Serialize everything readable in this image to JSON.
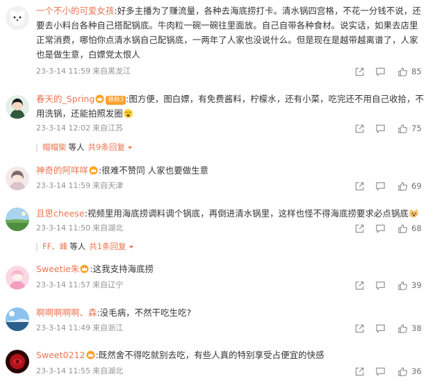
{
  "comments": [
    {
      "user": "一个不小的可爱女孩",
      "text": ":好多主播为了赚流量，各种去海底捞打卡。清水锅四宫格，不花一分钱不说，还要去小料台各种自己搭配锅底。牛肉粒一碗一碗往里面放。自己自带各种食材。说实话，如果去店里正常消费，哪怕你点清水锅自己配锅底，一两年了人家也没说什么。但是现在是越带越离谱了，人家也是做生意，白嫖党太恨人",
      "time": "23-3-14 11:59",
      "location": "来自黑龙江",
      "likes": "85"
    },
    {
      "user": "春天的_Spring",
      "fan_badge": "铁粉3",
      "text": ":图方便，图白嫖，有免费酱料，柠檬水，还有小菜，吃完还不用自己收拾，不用洗锅，还能拍照发圈",
      "time": "23-3-14 12:02",
      "location": "来自江苏",
      "likes": "75",
      "replies": {
        "name": "帽帽柴",
        "suffix": "等人",
        "more": "共9条回复"
      }
    },
    {
      "user": "神奇的阿咩咩",
      "text": ":很难不赞同 人家也要做生意",
      "time": "23-3-14 11:59",
      "location": "来自天津",
      "likes": "69"
    },
    {
      "user": "且思cheese",
      "text": ":视频里用海底捞调料调个锅底，再倒进清水锅里，这样也怪不得海底捞要求必点锅底",
      "time": "23-3-14 11:50",
      "location": "来自湖北",
      "likes": "68",
      "replies": {
        "name": "FF、峰",
        "suffix": "等人",
        "more": "共1条回复"
      }
    },
    {
      "user": "Sweetie朱",
      "text": ":这我支持海底捞",
      "time": "23-3-14 11:57",
      "location": "来自辽宁",
      "likes": "39"
    },
    {
      "user": "啊啊啊啊啊、森",
      "text": ":没毛病，不然干吃生吃?",
      "time": "23-3-14 11:49",
      "location": "来自浙江",
      "likes": "38"
    },
    {
      "user": "Sweet0212",
      "text": ":既然舍不得吃就别去吃，有些人真的特别享受占便宜的快感",
      "time": "23-3-14 11:55",
      "location": "来自湖北",
      "likes": "36"
    }
  ],
  "icons": {
    "share": "share-icon",
    "comment": "comment-icon",
    "like": "like-icon",
    "crown": "crown-badge-icon"
  },
  "colors": {
    "username": "#eb7350",
    "meta": "#939393",
    "icon": "#8a8a8a"
  }
}
